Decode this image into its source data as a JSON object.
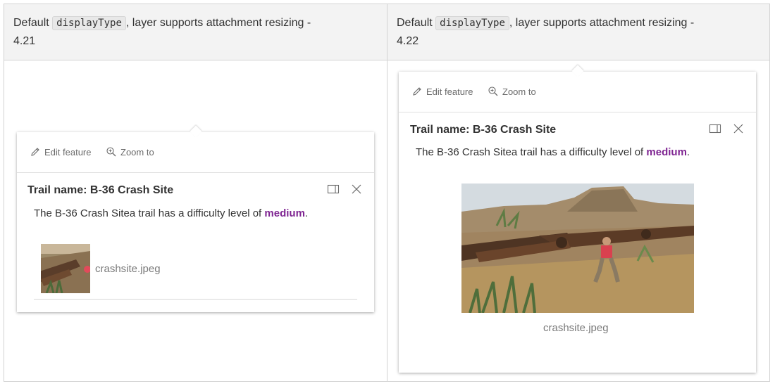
{
  "table": {
    "col1_header": {
      "prefix": "Default",
      "code": "displayType",
      "suffix": ", layer supports attachment resizing -",
      "version": "4.21"
    },
    "col2_header": {
      "prefix": "Default",
      "code": "displayType",
      "suffix": ", layer supports attachment resizing -",
      "version": "4.22"
    }
  },
  "popup_421": {
    "actions": {
      "edit": "Edit feature",
      "zoom": "Zoom to"
    },
    "title": "Trail name: B-36 Crash Site",
    "text_before": "The B-36 Crash Sitea trail has a difficulty level of ",
    "text_emphasis": "medium",
    "text_after": ".",
    "attachment_name": "crashsite.jpeg",
    "icons": {
      "edit": "pencil-icon",
      "zoom": "zoom-in-icon",
      "dock": "dock-icon",
      "close": "close-icon"
    }
  },
  "popup_422": {
    "actions": {
      "edit": "Edit feature",
      "zoom": "Zoom to"
    },
    "title": "Trail name: B-36 Crash Site",
    "text_before": "The B-36 Crash Sitea trail has a difficulty level of ",
    "text_emphasis": "medium",
    "text_after": ".",
    "attachment_name": "crashsite.jpeg",
    "icons": {
      "edit": "pencil-icon",
      "zoom": "zoom-in-icon",
      "dock": "dock-icon",
      "close": "close-icon"
    }
  },
  "colors": {
    "emphasis": "#7f2592",
    "header_bg": "#f3f3f3",
    "border": "#d3d3d3"
  }
}
